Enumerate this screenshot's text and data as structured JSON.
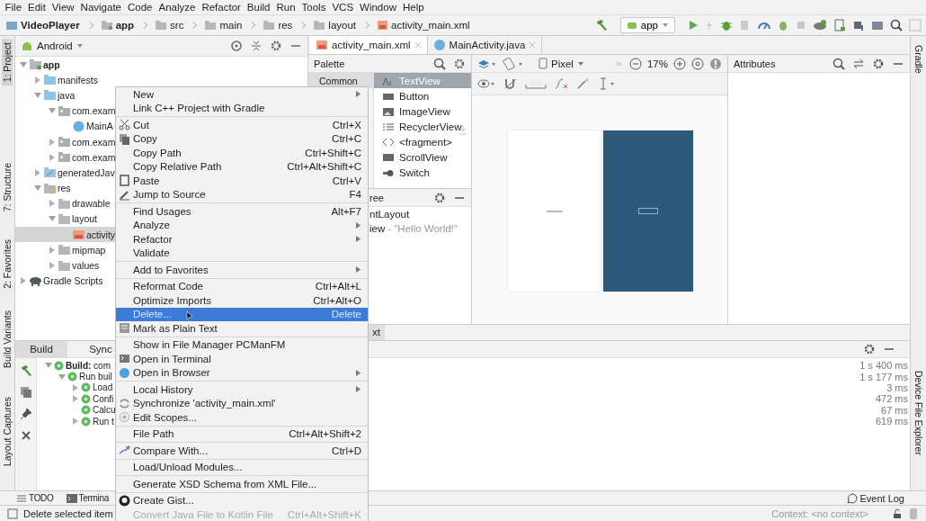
{
  "menu_bar": [
    "File",
    "Edit",
    "View",
    "Navigate",
    "Code",
    "Analyze",
    "Refactor",
    "Build",
    "Run",
    "Tools",
    "VCS",
    "Window",
    "Help"
  ],
  "breadcrumbs": [
    {
      "label": "VideoPlayer",
      "kind": "project"
    },
    {
      "label": "app",
      "kind": "module"
    },
    {
      "label": "src",
      "kind": "folder"
    },
    {
      "label": "main",
      "kind": "folder"
    },
    {
      "label": "res",
      "kind": "folder"
    },
    {
      "label": "layout",
      "kind": "folder"
    },
    {
      "label": "activity_main.xml",
      "kind": "layout_file"
    }
  ],
  "run_toolbar": {
    "configuration": "app"
  },
  "left_tool_tabs": [
    {
      "label": "1: Project",
      "selected": true
    },
    {
      "label": "7: Structure",
      "selected": false
    },
    {
      "label": "2: Favorites",
      "selected": false
    },
    {
      "label": "Build Variants",
      "selected": false
    },
    {
      "label": "Layout Captures",
      "selected": false
    }
  ],
  "right_tool_tabs": [
    {
      "label": "Gradle"
    },
    {
      "label": "Device File Explorer"
    }
  ],
  "project_panel": {
    "view": "Android",
    "tree": [
      {
        "label": "app",
        "kind": "module",
        "expanded": true,
        "selected": false,
        "children": [
          {
            "label": "manifests",
            "kind": "source_folder",
            "expanded": false,
            "selected": false
          },
          {
            "label": "java",
            "kind": "source_folder",
            "expanded": true,
            "selected": false,
            "children": [
              {
                "label": "com.exam",
                "kind": "package",
                "expanded": true,
                "selected": false,
                "children": [
                  {
                    "label": "MainA",
                    "kind": "class",
                    "selected": false
                  }
                ]
              },
              {
                "label": "com.exam",
                "kind": "package",
                "expanded": false,
                "selected": false
              },
              {
                "label": "com.exam",
                "kind": "package",
                "expanded": false,
                "selected": false
              }
            ]
          },
          {
            "label": "generatedJav",
            "kind": "generated_folder",
            "expanded": false,
            "selected": false
          },
          {
            "label": "res",
            "kind": "resource_folder",
            "expanded": true,
            "selected": false,
            "children": [
              {
                "label": "drawable",
                "kind": "folder",
                "expanded": false,
                "selected": false
              },
              {
                "label": "layout",
                "kind": "folder",
                "expanded": true,
                "selected": false,
                "children": [
                  {
                    "label": "activity",
                    "kind": "layout_file",
                    "selected": true
                  }
                ]
              },
              {
                "label": "mipmap",
                "kind": "folder",
                "expanded": false,
                "selected": false
              },
              {
                "label": "values",
                "kind": "folder",
                "expanded": false,
                "selected": false
              }
            ]
          }
        ]
      },
      {
        "label": "Gradle Scripts",
        "kind": "gradle",
        "expanded": false,
        "selected": false
      }
    ]
  },
  "editor_tabs": [
    {
      "label": "activity_main.xml",
      "kind": "layout_file",
      "selected": true
    },
    {
      "label": "MainActivity.java",
      "kind": "class",
      "selected": false
    }
  ],
  "palette": {
    "title": "Palette",
    "categories": [
      {
        "label": "Common",
        "selected": true
      }
    ],
    "items": [
      {
        "label": "TextView",
        "kind": "text",
        "selected": true
      },
      {
        "label": "Button",
        "kind": "button",
        "selected": false
      },
      {
        "label": "ImageView",
        "kind": "image",
        "selected": false
      },
      {
        "label": "RecyclerView",
        "kind": "list",
        "selected": false
      },
      {
        "label": "<fragment>",
        "kind": "code",
        "selected": false
      },
      {
        "label": "ScrollView",
        "kind": "scroll",
        "selected": false
      },
      {
        "label": "Switch",
        "kind": "switch",
        "selected": false
      }
    ]
  },
  "design_toolbar": {
    "device": "Pixel",
    "zoom": "17%"
  },
  "component_tree": {
    "title": "ree",
    "nodes": [
      {
        "label": "ntLayout"
      },
      {
        "label": "iew",
        "detail": "- \"Hello World!\""
      }
    ]
  },
  "attributes": {
    "title": "Attributes"
  },
  "editor_mode_tab": {
    "label": "xt"
  },
  "build_panel": {
    "tabs": [
      {
        "label": "Build",
        "selected": true
      },
      {
        "label": "Sync",
        "selected": false
      }
    ],
    "tree": [
      {
        "label": "**Build:** com",
        "time": "1 s 400 ms",
        "expanded": true,
        "children": [
          {
            "label": "Run buil",
            "time": "1 s 177 ms",
            "expanded": true,
            "children": [
              {
                "label": "Load",
                "time": "3 ms",
                "expanded": false
              },
              {
                "label": "Confi",
                "time": "472 ms",
                "expanded": false
              },
              {
                "label": "Calcu",
                "time": "67 ms"
              },
              {
                "label": "Run t",
                "time": "619 ms",
                "expanded": false
              }
            ]
          }
        ]
      }
    ]
  },
  "context_menu": {
    "groups": [
      [
        {
          "label": "New",
          "submenu": true,
          "selected": false,
          "disabled": false
        },
        {
          "label": "Link C++ Project with Gradle",
          "selected": false,
          "disabled": false
        }
      ],
      [
        {
          "label": "Cut",
          "shortcut": "Ctrl+X",
          "kind": "scissors",
          "selected": false,
          "disabled": false
        },
        {
          "label": "Copy",
          "shortcut": "Ctrl+C",
          "kind": "copy",
          "selected": false,
          "disabled": false
        },
        {
          "label": "Copy Path",
          "shortcut": "Ctrl+Shift+C",
          "selected": false,
          "disabled": false
        },
        {
          "label": "Copy Relative Path",
          "shortcut": "Ctrl+Alt+Shift+C",
          "selected": false,
          "disabled": false
        },
        {
          "label": "Paste",
          "shortcut": "Ctrl+V",
          "kind": "paste",
          "selected": false,
          "disabled": false
        },
        {
          "label": "Jump to Source",
          "shortcut": "F4",
          "kind": "pencil",
          "selected": false,
          "disabled": false
        }
      ],
      [
        {
          "label": "Find Usages",
          "shortcut": "Alt+F7",
          "selected": false,
          "disabled": false
        },
        {
          "label": "Analyze",
          "submenu": true,
          "selected": false,
          "disabled": false
        },
        {
          "label": "Refactor",
          "submenu": true,
          "selected": false,
          "disabled": false
        },
        {
          "label": "Validate",
          "selected": false,
          "disabled": false
        }
      ],
      [
        {
          "label": "Add to Favorites",
          "submenu": true,
          "selected": false,
          "disabled": false
        }
      ],
      [
        {
          "label": "Reformat Code",
          "shortcut": "Ctrl+Alt+L",
          "selected": false,
          "disabled": false
        },
        {
          "label": "Optimize Imports",
          "shortcut": "Ctrl+Alt+O",
          "selected": false,
          "disabled": false
        },
        {
          "label": "Delete...",
          "shortcut": "Delete",
          "selected": true,
          "disabled": false
        },
        {
          "label": "Mark as Plain Text",
          "kind": "text_file",
          "selected": false,
          "disabled": false
        }
      ],
      [
        {
          "label": "Show in File Manager PCManFM",
          "selected": false,
          "disabled": false
        },
        {
          "label": "Open in Terminal",
          "kind": "terminal",
          "selected": false,
          "disabled": false
        },
        {
          "label": "Open in Browser",
          "kind": "globe",
          "submenu": true,
          "selected": false,
          "disabled": false
        }
      ],
      [
        {
          "label": "Local History",
          "submenu": true,
          "selected": false,
          "disabled": false
        },
        {
          "label": "Synchronize 'activity_main.xml'",
          "kind": "sync",
          "selected": false,
          "disabled": false
        },
        {
          "label": "Edit Scopes...",
          "kind": "scope",
          "selected": false,
          "disabled": false
        }
      ],
      [
        {
          "label": "File Path",
          "shortcut": "Ctrl+Alt+Shift+2",
          "selected": false,
          "disabled": false
        }
      ],
      [
        {
          "label": "Compare With...",
          "shortcut": "Ctrl+D",
          "kind": "compare",
          "selected": false,
          "disabled": false
        }
      ],
      [
        {
          "label": "Load/Unload Modules...",
          "selected": false,
          "disabled": false
        }
      ],
      [
        {
          "label": "Generate XSD Schema from XML File...",
          "selected": false,
          "disabled": false
        }
      ],
      [
        {
          "label": "Create Gist...",
          "kind": "github",
          "selected": false,
          "disabled": false
        },
        {
          "label": "Convert Java File to Kotlin File",
          "shortcut": "Ctrl+Alt+Shift+K",
          "selected": false,
          "disabled": true
        }
      ]
    ]
  },
  "bottom_tool_tabs": [
    {
      "label": "TODO",
      "kind": "list"
    },
    {
      "label": "Termina",
      "kind": "terminal"
    }
  ],
  "event_log": {
    "label": "Event Log"
  },
  "status_bar": {
    "message": "Delete selected item",
    "context": "Context: <no context>"
  }
}
